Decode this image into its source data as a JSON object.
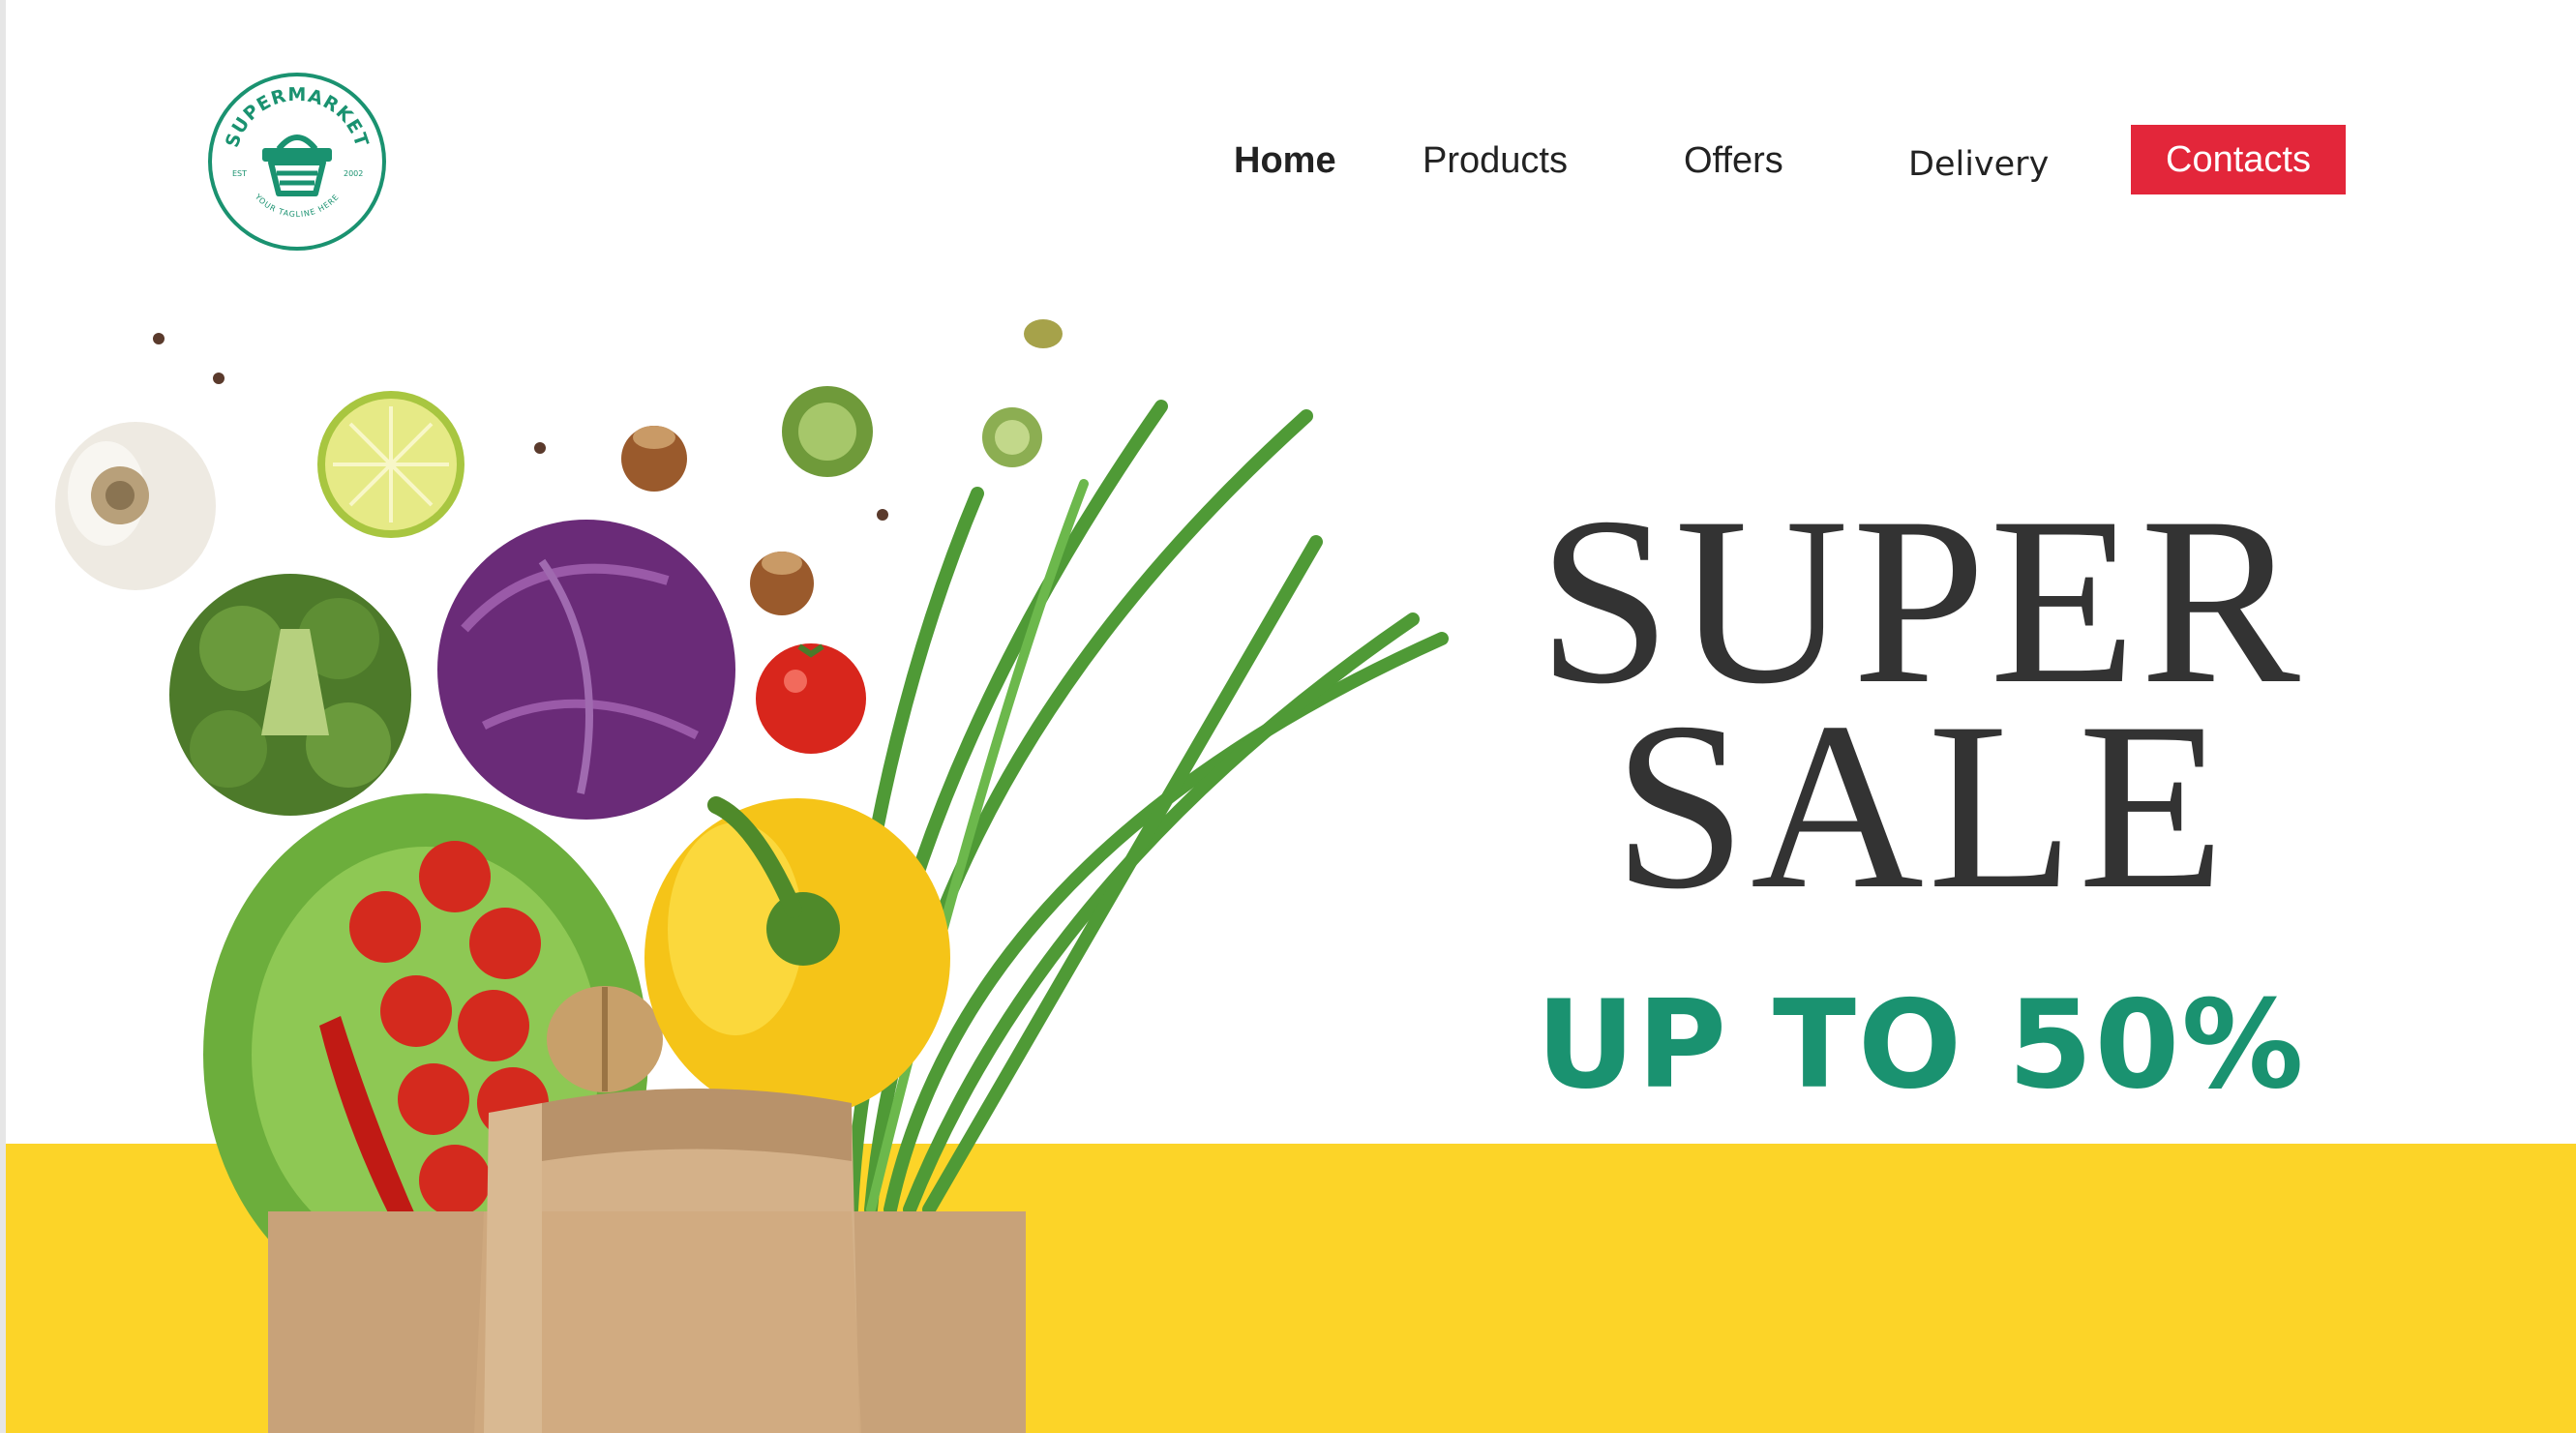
{
  "logo": {
    "name": "SUPERMARKET",
    "est": "EST",
    "year": "2002",
    "tagline": "YOUR TAGLINE HERE",
    "color": "#1a9270"
  },
  "nav": {
    "home": "Home",
    "products": "Products",
    "offers": "Offers",
    "delivery": "Delivery",
    "contacts": "Contacts"
  },
  "hero": {
    "line1": "SUPER",
    "line2": "SALE",
    "promo": "UP TO 50%"
  },
  "colors": {
    "accent_red": "#e3263a",
    "promo_green": "#1a9270",
    "band_yellow": "#fcd428",
    "headline_gray": "#333333"
  },
  "icons": [
    "basket-icon"
  ]
}
